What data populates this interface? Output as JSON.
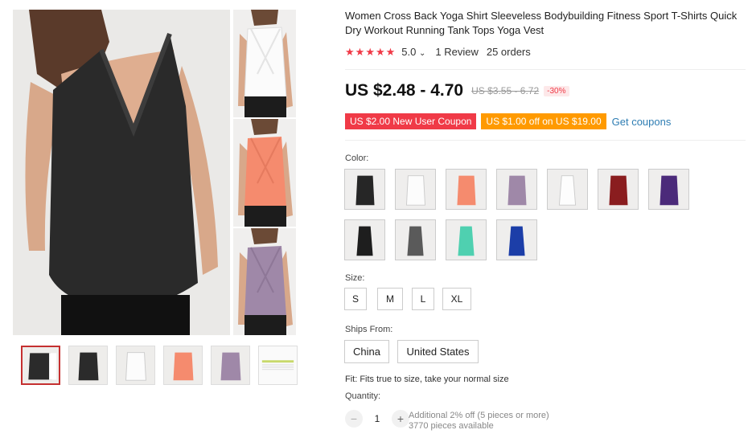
{
  "product": {
    "title": "Women Cross Back Yoga Shirt Sleeveless Bodybuilding Fitness Sport T-Shirts Quick Dry Workout Running Tank Tops Yoga Vest"
  },
  "rating": {
    "stars": 5,
    "value": "5.0",
    "dropdown_glyph": "⌄",
    "reviews": "1 Review",
    "orders": "25 orders"
  },
  "price": {
    "current": "US $2.48 - 4.70",
    "original": "US $3.55 - 6.72",
    "discount": "-30%"
  },
  "coupons": {
    "new_user": "US $2.00 New User Coupon",
    "off": "US $1.00 off on US $19.00",
    "get": "Get coupons"
  },
  "color": {
    "label": "Color:",
    "swatches": [
      "black",
      "white",
      "coral",
      "lavender",
      "white-racer",
      "burgundy",
      "purple",
      "black-racer",
      "gray-racer",
      "mint-racer",
      "royal-blue-racer"
    ]
  },
  "size": {
    "label": "Size:",
    "options": [
      "S",
      "M",
      "L",
      "XL"
    ]
  },
  "ships_from": {
    "label": "Ships From:",
    "options": [
      "China",
      "United States"
    ]
  },
  "fit": "Fit: Fits true to size, take your normal size",
  "quantity": {
    "label": "Quantity:",
    "value": "1",
    "minus": "−",
    "plus": "+",
    "note1": "Additional 2% off (5 pieces or more)",
    "note2": "3770 pieces available"
  },
  "colors": {
    "star": "#f03a47",
    "coupon_red": "#f03a47",
    "coupon_orange": "#ff9a00",
    "link": "#2e7db3",
    "active_thumb": "#c53030"
  }
}
